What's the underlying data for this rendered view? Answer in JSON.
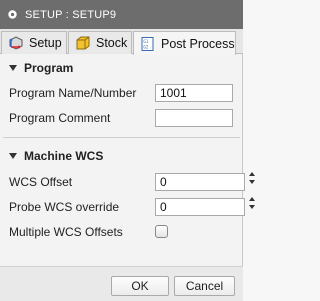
{
  "window": {
    "title": "SETUP : SETUP9",
    "title_icon": "pinned-dot-icon"
  },
  "tabs": [
    {
      "label": "Setup",
      "icon": "setup-icon",
      "active": false
    },
    {
      "label": "Stock",
      "icon": "stock-cube-icon",
      "active": false
    },
    {
      "label": "Post Process",
      "icon": "post-process-icon",
      "active": true
    }
  ],
  "program": {
    "header": "Program",
    "name_label": "Program Name/Number",
    "name_value": "1001",
    "comment_label": "Program Comment",
    "comment_value": ""
  },
  "machine_wcs": {
    "header": "Machine WCS",
    "wcs_offset_label": "WCS Offset",
    "wcs_offset_value": "0",
    "probe_label": "Probe WCS override",
    "probe_value": "0",
    "multiple_label": "Multiple WCS Offsets",
    "multiple_checked": false
  },
  "footer": {
    "ok_label": "OK",
    "cancel_label": "Cancel"
  },
  "colors": {
    "titlebar": "#6d6d6d",
    "setup_icon_blue": "#2a6fd6",
    "stock_icon_yellow": "#f2c230"
  }
}
